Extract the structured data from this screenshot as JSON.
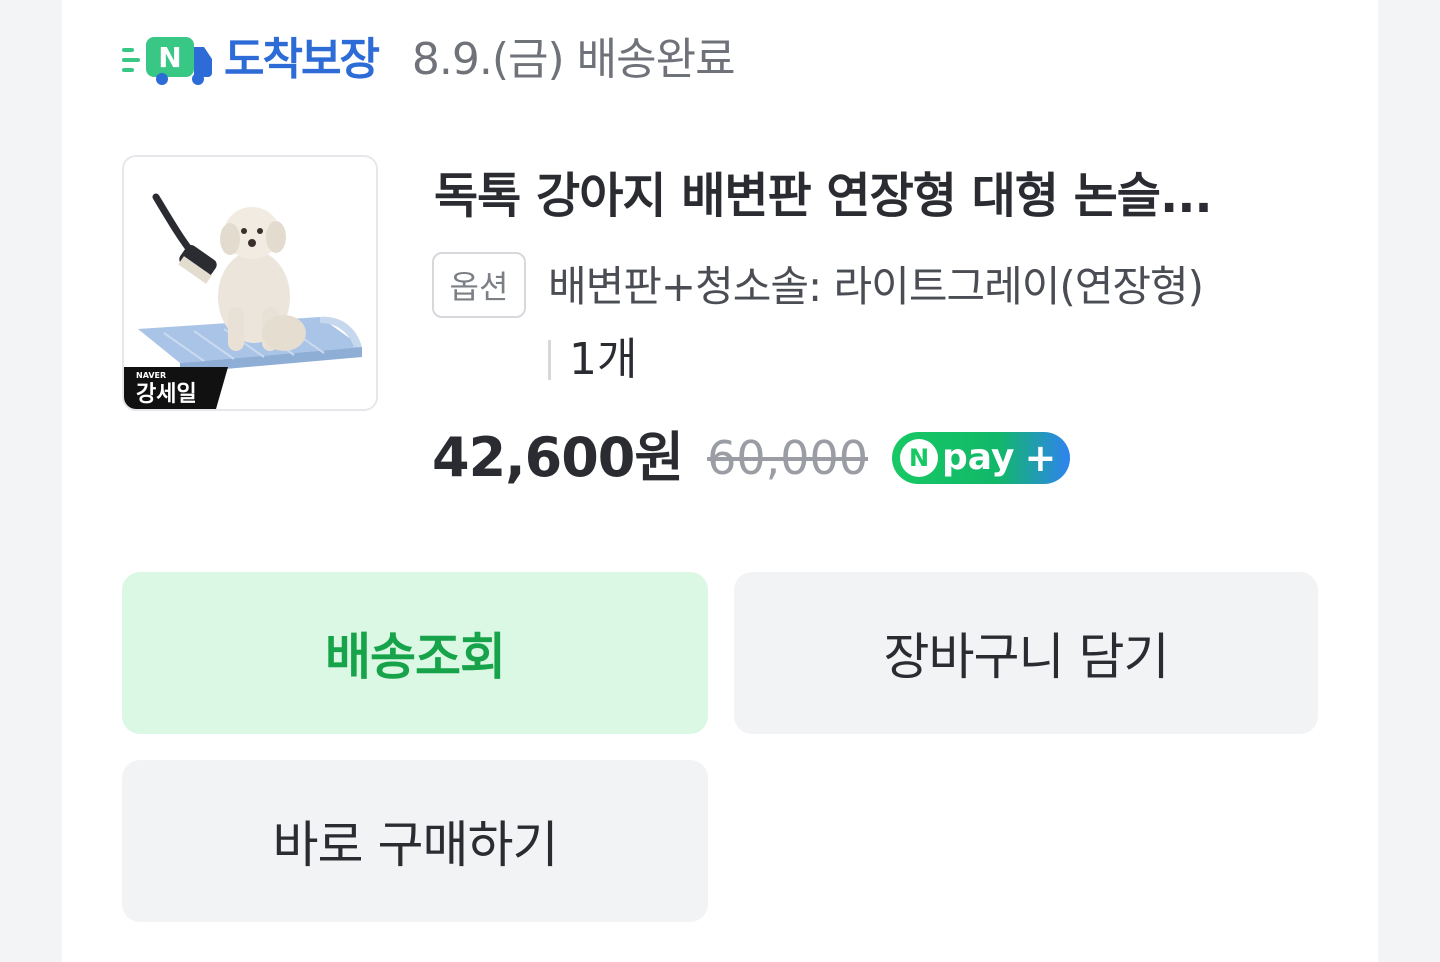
{
  "delivery": {
    "badge_logo_letter": "N",
    "badge_label": "도착보장",
    "status": "8.9.(금) 배송완료"
  },
  "product": {
    "image_alt": "dog sitting on pet toilet tray with cleaning brush",
    "sale_badge_top": "NAVER",
    "sale_badge_main": "강세일",
    "title": "독톡 강아지 배변판 연장형 대형 논슬...",
    "option_chip": "옵션",
    "option_text": "배변판+청소솔: 라이트그레이(연장형)",
    "quantity": "1개",
    "price": "42,600원",
    "original_price": "60,000",
    "npay": {
      "n": "N",
      "text": "pay",
      "plus": "+"
    }
  },
  "buttons": {
    "track": "배송조회",
    "cart": "장바구니 담기",
    "buy_now": "바로 구매하기"
  },
  "colors": {
    "badge_blue": "#2d6bd6",
    "badge_green": "#39c785",
    "track_bg": "#dbf8e4",
    "track_text": "#17a34a",
    "button_bg": "#f2f3f5"
  },
  "icons": {
    "delivery_truck": "delivery-truck-icon",
    "npay_logo": "npay-icon"
  }
}
